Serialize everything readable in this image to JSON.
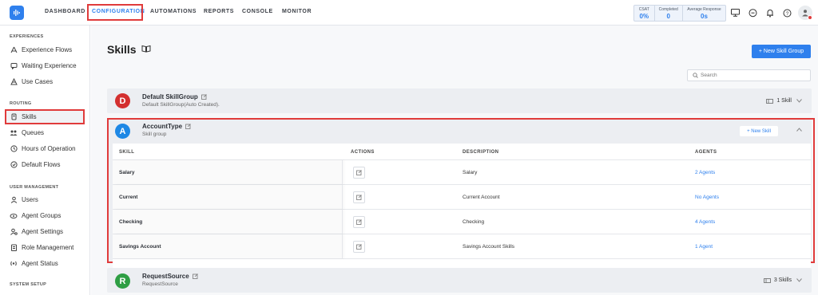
{
  "nav": {
    "items": [
      "DASHBOARD",
      "CONFIGURATION",
      "AUTOMATIONS",
      "REPORTS",
      "CONSOLE",
      "MONITOR"
    ],
    "active": "CONFIGURATION"
  },
  "stats": [
    {
      "label": "CSAT",
      "value": "0%"
    },
    {
      "label": "Completed",
      "value": "0"
    },
    {
      "label": "Average Response",
      "value": "0s"
    }
  ],
  "top_icons": [
    "monitor-icon",
    "chat-icon",
    "bell-icon",
    "help-icon",
    "user-icon"
  ],
  "sidebar": {
    "sections": {
      "experiences": "EXPERIENCES",
      "routing": "ROUTING",
      "user_management": "USER MANAGEMENT",
      "system_setup": "SYSTEM SETUP"
    },
    "items": [
      {
        "label": "Experience Flows",
        "icon": "flow-icon"
      },
      {
        "label": "Waiting Experience",
        "icon": "chat-icon"
      },
      {
        "label": "Use Cases",
        "icon": "usecase-icon"
      },
      {
        "label": "Skills",
        "icon": "skills-icon"
      },
      {
        "label": "Queues",
        "icon": "queues-icon"
      },
      {
        "label": "Hours of Operation",
        "icon": "clock-icon"
      },
      {
        "label": "Default Flows",
        "icon": "default-flow-icon"
      },
      {
        "label": "Users",
        "icon": "users-icon"
      },
      {
        "label": "Agent Groups",
        "icon": "agent-groups-icon"
      },
      {
        "label": "Agent Settings",
        "icon": "agent-settings-icon"
      },
      {
        "label": "Role Management",
        "icon": "role-icon"
      },
      {
        "label": "Agent Status",
        "icon": "status-icon"
      }
    ]
  },
  "page": {
    "title": "Skills",
    "new_group_label": "+ New Skill Group",
    "search_placeholder": "Search"
  },
  "groups": [
    {
      "initial": "D",
      "color": "#d32f2f",
      "name": "Default SkillGroup",
      "subtitle": "Default SkillGroup(Auto Created).",
      "count": "1 Skill"
    },
    {
      "initial": "A",
      "color": "#1e88e5",
      "name": "AccountType",
      "subtitle": "Skill group",
      "new_skill_label": "+ New Skill"
    },
    {
      "initial": "R",
      "color": "#2e9e44",
      "name": "RequestSource",
      "subtitle": "RequestSource",
      "count": "3 Skills"
    }
  ],
  "table": {
    "headers": [
      "SKILL",
      "ACTIONS",
      "DESCRIPTION",
      "AGENTS"
    ],
    "rows": [
      {
        "skill": "Salary",
        "description": "Salary",
        "agents": "2 Agents"
      },
      {
        "skill": "Current",
        "description": "Current Account",
        "agents": "No Agents"
      },
      {
        "skill": "Checking",
        "description": "Checking",
        "agents": "4 Agents"
      },
      {
        "skill": "Savings Account",
        "description": "Savings Account Skills",
        "agents": "1 Agent"
      }
    ]
  }
}
